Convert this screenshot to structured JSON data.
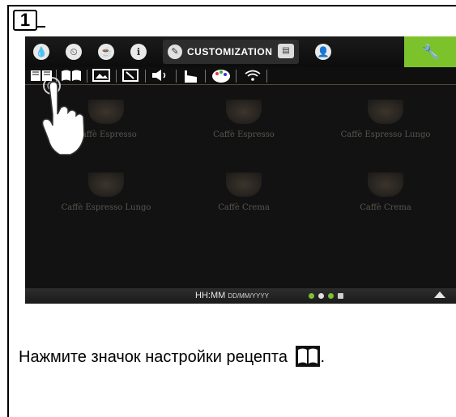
{
  "step": {
    "number": "1"
  },
  "topbar": {
    "active_tab_label": "CUSTOMIZATION",
    "tabs": [
      "drop-icon",
      "clock-icon",
      "cup-icon",
      "info-icon",
      "pencil-icon",
      "display-icon",
      "user-icon",
      "wrench-icon"
    ],
    "accent_color": "#7cc22b"
  },
  "subbar": {
    "icons": [
      "recipe-book-icon",
      "open-book-icon",
      "picture-icon",
      "tilted-image-icon",
      "speaker-icon",
      "pot-icon",
      "palette-icon",
      "wifi-icon"
    ]
  },
  "products": [
    {
      "name": "Caffè Espresso"
    },
    {
      "name": "Caffè Espresso"
    },
    {
      "name": "Caffè Espresso Lungo"
    },
    {
      "name": "Caffè Espresso Lungo"
    },
    {
      "name": "Caffè Crema"
    },
    {
      "name": "Caffè Crema"
    }
  ],
  "statusbar": {
    "time": "HH:MM",
    "date": "DD/MM/YYYY"
  },
  "instruction": {
    "text": "Нажмите значок настройки рецепта",
    "end": "."
  }
}
